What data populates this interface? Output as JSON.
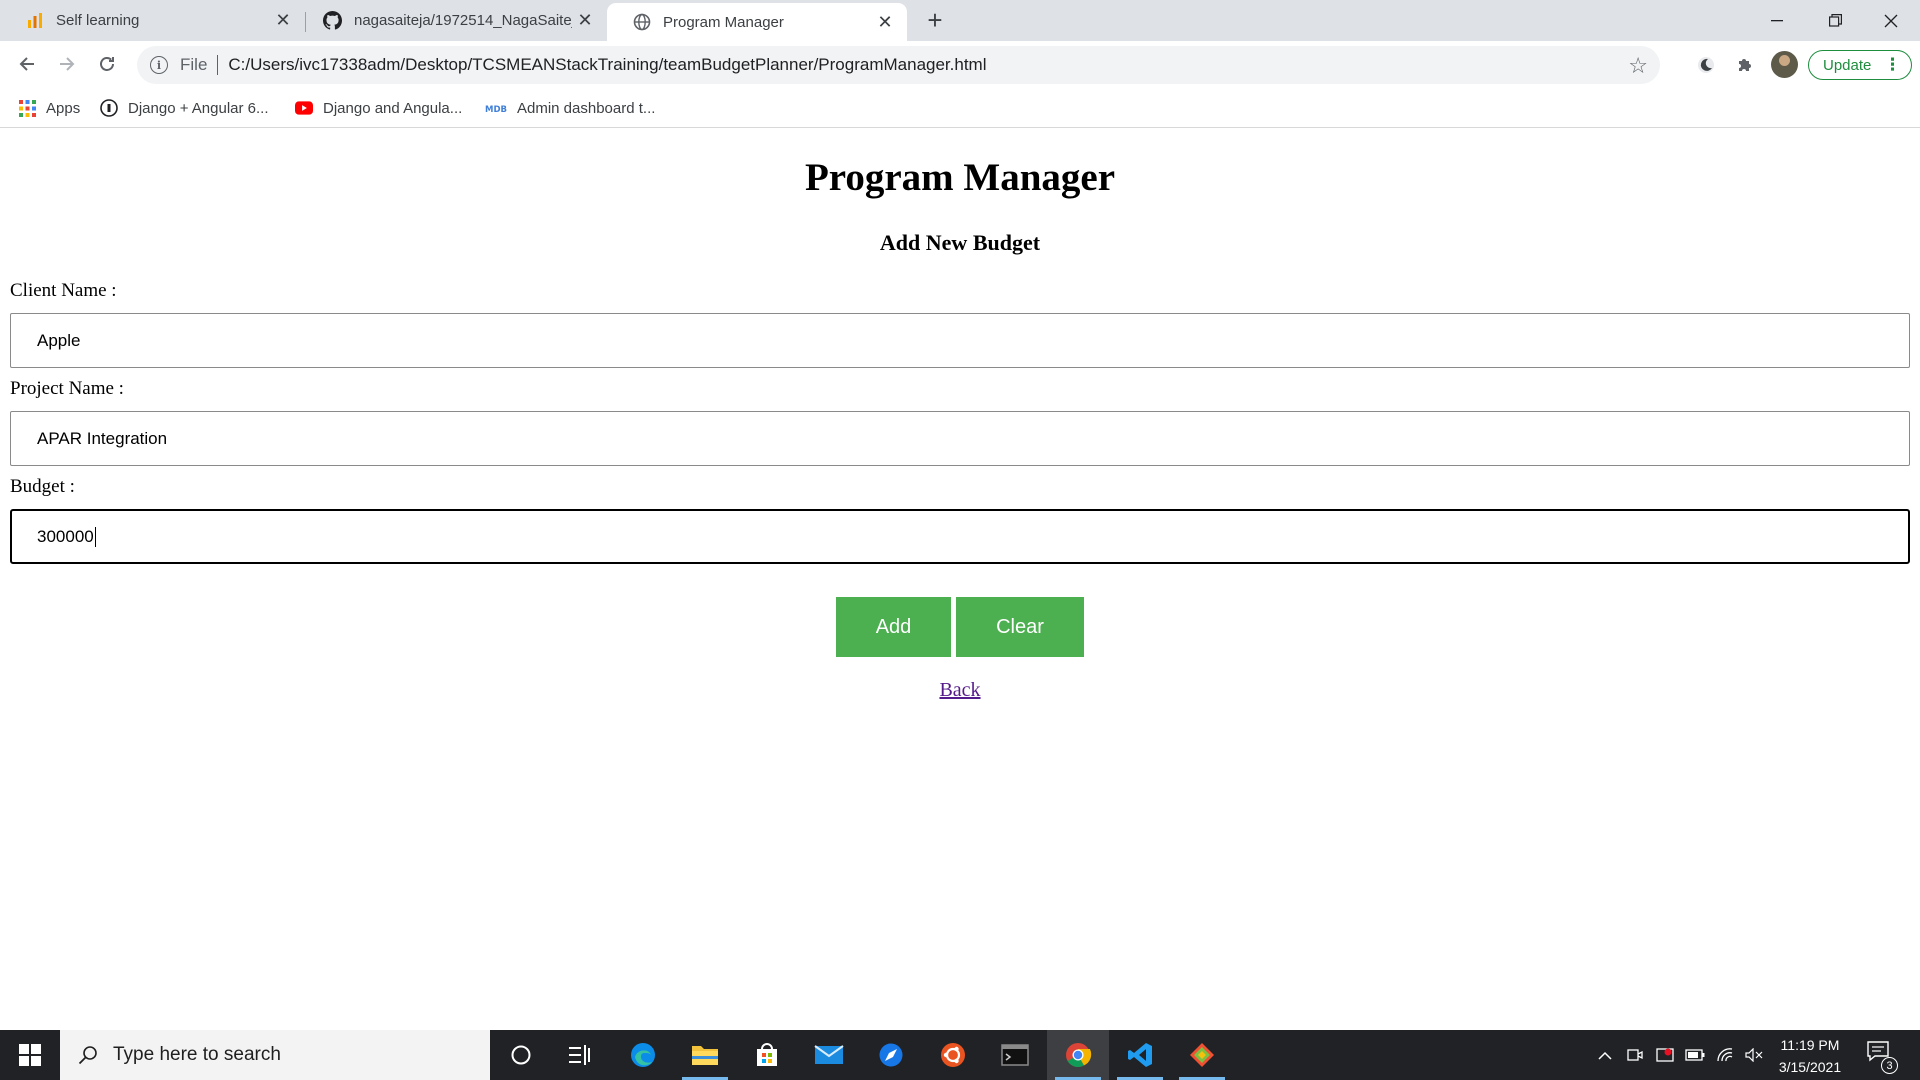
{
  "browser": {
    "tabs": [
      {
        "title": "Self learning",
        "icon": "analytics-icon"
      },
      {
        "title": "nagasaiteja/1972514_NagaSaiteja",
        "icon": "github-icon"
      },
      {
        "title": "Program Manager",
        "icon": "globe-icon",
        "active": true
      }
    ],
    "address": {
      "scheme_label": "File",
      "url": "C:/Users/ivc17338adm/Desktop/TCSMEANStackTraining/teamBudgetPlanner/ProgramManager.html"
    },
    "update_label": "Update",
    "bookmarks": [
      {
        "label": "Apps",
        "icon": "apps-grid-icon"
      },
      {
        "label": "Django + Angular 6...",
        "icon": "github-icon"
      },
      {
        "label": "Django and Angula...",
        "icon": "youtube-icon"
      },
      {
        "label": "Admin dashboard t...",
        "icon": "mdb-icon"
      }
    ]
  },
  "page": {
    "title": "Program Manager",
    "subtitle": "Add New Budget",
    "form": {
      "client_label": "Client Name :",
      "client_value": "Apple",
      "project_label": "Project Name :",
      "project_value": "APAR Integration",
      "budget_label": "Budget :",
      "budget_value": "300000"
    },
    "add_label": "Add",
    "clear_label": "Clear",
    "back_label": "Back"
  },
  "taskbar": {
    "search_placeholder": "Type here to search",
    "time": "11:19 PM",
    "date": "3/15/2021",
    "notification_count": "3"
  },
  "colors": {
    "button_green": "#4caf50",
    "visited_link": "#551a8b",
    "update_green": "#1e8e3e"
  }
}
